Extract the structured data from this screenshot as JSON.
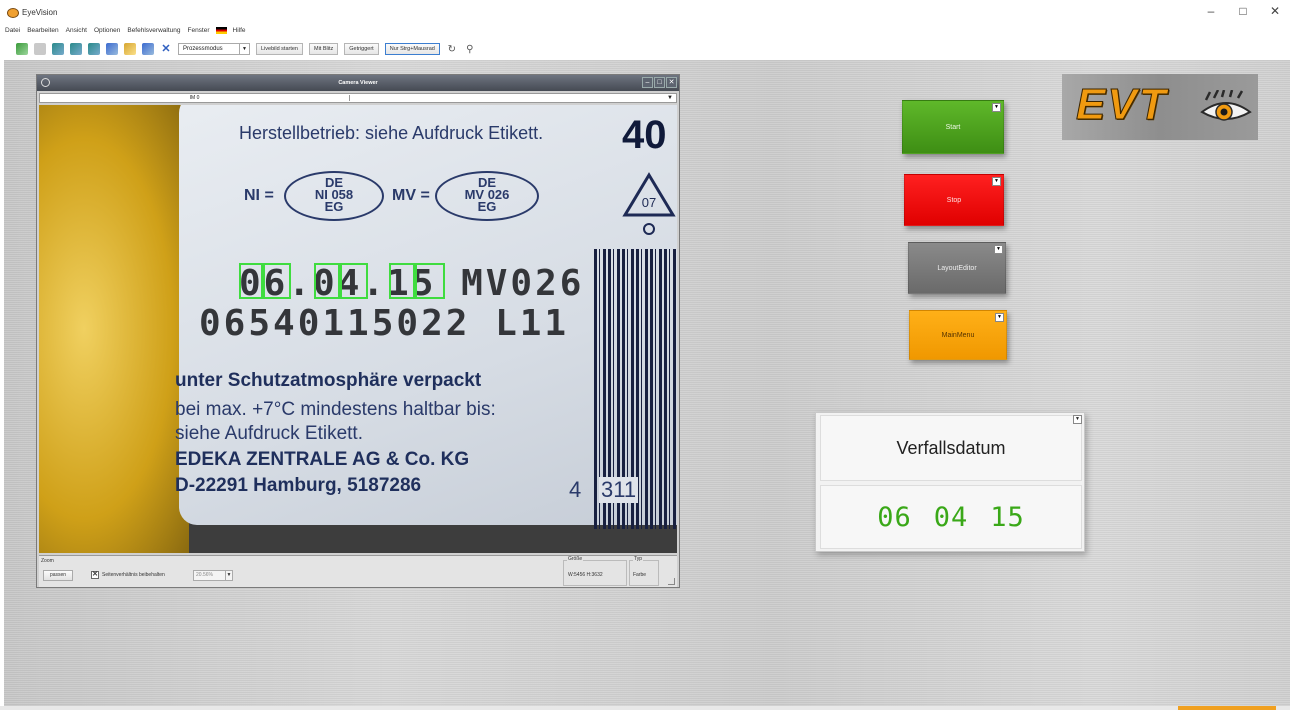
{
  "app": {
    "title": "EyeVision",
    "window_controls": {
      "minimize": "–",
      "maximize": "□",
      "close": "✕"
    }
  },
  "menubar": {
    "items": [
      "Datei",
      "Bearbeiten",
      "Ansicht",
      "Optionen",
      "Befehlsverwaltung",
      "Fenster",
      "Hilfe"
    ]
  },
  "toolbar": {
    "mode_select": "Prozessmodus",
    "buttons": [
      "Livebild starten",
      "Mit Blitz",
      "Getriggert",
      "Nur Strg+Mausrad"
    ]
  },
  "viewer": {
    "title": "Camera Viewer",
    "tab": "IM 0",
    "footer": {
      "zoom_label": "Zoom",
      "fit_button": "passen",
      "keep_ratio_label": "Seitenverhältnis beibehalten",
      "zoom_value": "20.56%",
      "size_label": "Größe",
      "size_value": "W:5456  H:3632",
      "type_label": "Typ",
      "type_value": "Farbe"
    },
    "image_text": {
      "herstell": "Herstellbetrieb: siehe Aufdruck Etikett.",
      "forty": "40",
      "ni": "NI =",
      "ni_oval": [
        "DE",
        "NI 058",
        "EG"
      ],
      "mv": "MV =",
      "mv_oval": [
        "DE",
        "MV 026",
        "EG"
      ],
      "recycle_code": "07",
      "dot_line1": "06.04.15 MV026",
      "dot_line2": "06540115022 L11",
      "schutz": "unter Schutzatmosphäre verpackt",
      "bei": "bei max. +7°C mindestens haltbar bis:",
      "siehe": "siehe Aufdruck Etikett.",
      "edeka": "EDEKA ZENTRALE AG & Co. KG",
      "hamburg": "D-22291 Hamburg, 5187286",
      "four": "4",
      "code311": "311"
    }
  },
  "buttons": {
    "start": "Start",
    "stop": "Stop",
    "layout": "LayoutEditor",
    "main": "MainMenu",
    "corner_arrow": "▼"
  },
  "logo": {
    "text": "EVT"
  },
  "date_panel": {
    "title": "Verfallsdatum",
    "day": "06",
    "month": "04",
    "year": "15",
    "value_color": "#3aa818"
  },
  "colors": {
    "start": "#4ea31f",
    "stop": "#f00000",
    "layout": "#7a7a7a",
    "main": "#f8a40c",
    "logo_orange": "#f09a10"
  }
}
